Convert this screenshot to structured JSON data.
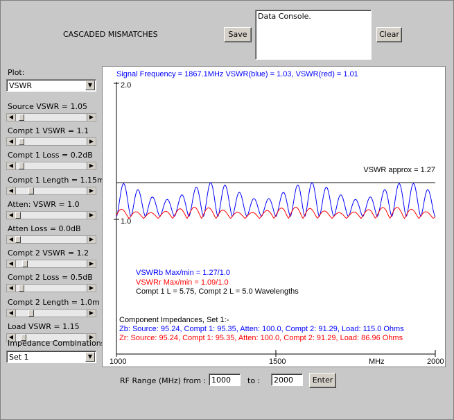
{
  "title": "CASCADED MISMATCHES",
  "buttons": {
    "save": "Save",
    "clear": "Clear",
    "enter": "Enter"
  },
  "console": {
    "text": "Data Console."
  },
  "left_panel": {
    "plot_label": "Plot:",
    "plot_select": "VSWR",
    "sliders": [
      {
        "label": "Source VSWR = 1.05",
        "level": 0.05
      },
      {
        "label": "Compt 1 VSWR = 1.1",
        "level": 0.05
      },
      {
        "label": "Compt 1 Loss = 0.2dB",
        "level": 0.05
      },
      {
        "label": "Compt 1 Length = 1.15m",
        "level": 0.2
      },
      {
        "label": "Atten: VSWR = 1.0",
        "level": 0.0
      },
      {
        "label": "Atten Loss = 0.0dB",
        "level": 0.0
      },
      {
        "label": "Compt 2 VSWR = 1.2",
        "level": 0.1
      },
      {
        "label": "Compt 2 Loss = 0.5dB",
        "level": 0.05
      },
      {
        "label": "Compt 2 Length = 1.0m",
        "level": 0.2
      },
      {
        "label": "Load VSWR = 1.15",
        "level": 0.08
      }
    ],
    "impedance_label": "Impedance Combinations",
    "impedance_select": "Set 1"
  },
  "plot": {
    "header": "Signal Frequency = 1867.1MHz    VSWR(blue) = 1.03,    VSWR(red) = 1.01",
    "y_top": "2.0",
    "y_bottom": "1.0",
    "approx_label": "VSWR approx = 1.27",
    "info": {
      "blue": "VSWRb Max/min = 1.27/1.0",
      "red": "VSWRr Max/min = 1.09/1.0",
      "black": "Compt 1 L = 5.75,  Compt 2 L = 5.0 Wavelengths"
    },
    "impedance_title": "Component Impedances, Set 1:-",
    "zb": "Zb: Source: 95.24, Compt 1: 95.35, Atten: 100.0, Compt 2: 91.29, Load: 115.0 Ohms",
    "zr": "Zr:  Source: 95.24, Compt 1: 95.35, Atten: 100.0, Compt 2: 91.29, Load: 86.96 Ohms",
    "x_ticks": [
      "1000",
      "1500",
      "MHz",
      "2000"
    ]
  },
  "colors": {
    "blue": "#0000ff",
    "red": "#ff0000",
    "background": "#c8c8c8"
  },
  "range": {
    "label_from": "RF Range (MHz) from :",
    "from": "1000",
    "label_to": "to :",
    "to": "2000"
  },
  "chart_data": {
    "type": "line",
    "xlim": [
      1000,
      2000
    ],
    "ylim": [
      1.0,
      2.0
    ],
    "reference_line": 1.27,
    "series": [
      {
        "name": "VSWR(blue)",
        "max": 1.27,
        "min": 1.0,
        "cycles": 22
      },
      {
        "name": "VSWR(red)",
        "max": 1.09,
        "min": 1.0,
        "cycles": 22
      }
    ]
  }
}
